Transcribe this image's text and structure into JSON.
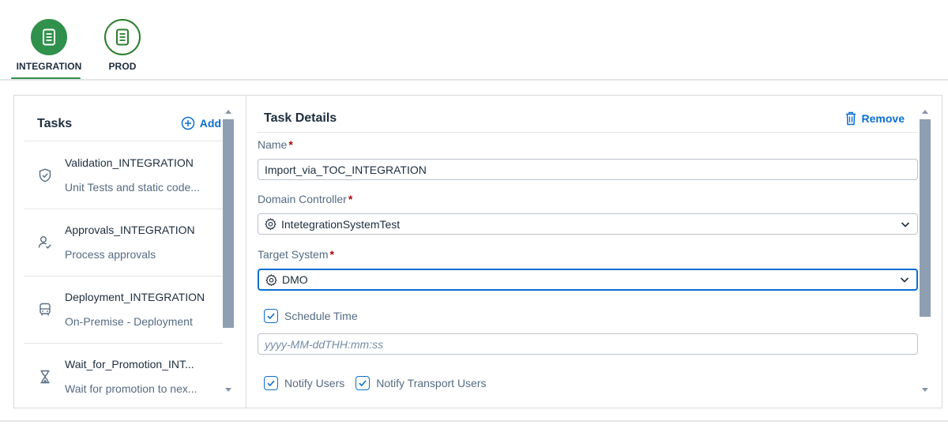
{
  "stages": [
    {
      "label": "INTEGRATION",
      "active": true,
      "icon": "document-icon"
    },
    {
      "label": "PROD",
      "active": false,
      "icon": "document-icon"
    }
  ],
  "tasks": {
    "title": "Tasks",
    "add_label": "Add",
    "items": [
      {
        "name": "Validation_INTEGRATION",
        "description": "Unit Tests and static code...",
        "icon": "shield-check-icon"
      },
      {
        "name": "Approvals_INTEGRATION",
        "description": "Process approvals",
        "icon": "user-check-icon"
      },
      {
        "name": "Deployment_INTEGRATION",
        "description": "On-Premise - Deployment",
        "icon": "bus-icon"
      },
      {
        "name": "Wait_for_Promotion_INT...",
        "description": "Wait for promotion to nex...",
        "icon": "hourglass-icon"
      }
    ]
  },
  "details": {
    "title": "Task Details",
    "remove_label": "Remove",
    "name_label": "Name",
    "name_value": "Import_via_TOC_INTEGRATION",
    "domain_controller_label": "Domain Controller",
    "domain_controller_value": "IntetegrationSystemTest",
    "target_system_label": "Target System",
    "target_system_value": "DMO",
    "schedule_time_label": "Schedule Time",
    "schedule_time_checked": true,
    "schedule_placeholder": "yyyy-MM-ddTHH:mm:ss",
    "notify_users_label": "Notify Users",
    "notify_users_checked": true,
    "notify_transport_users_label": "Notify Transport Users",
    "notify_transport_users_checked": true,
    "required_marker": "*"
  },
  "colors": {
    "accent": "#0a6ed1",
    "stage_green": "#30914c",
    "required": "#aa0808"
  }
}
